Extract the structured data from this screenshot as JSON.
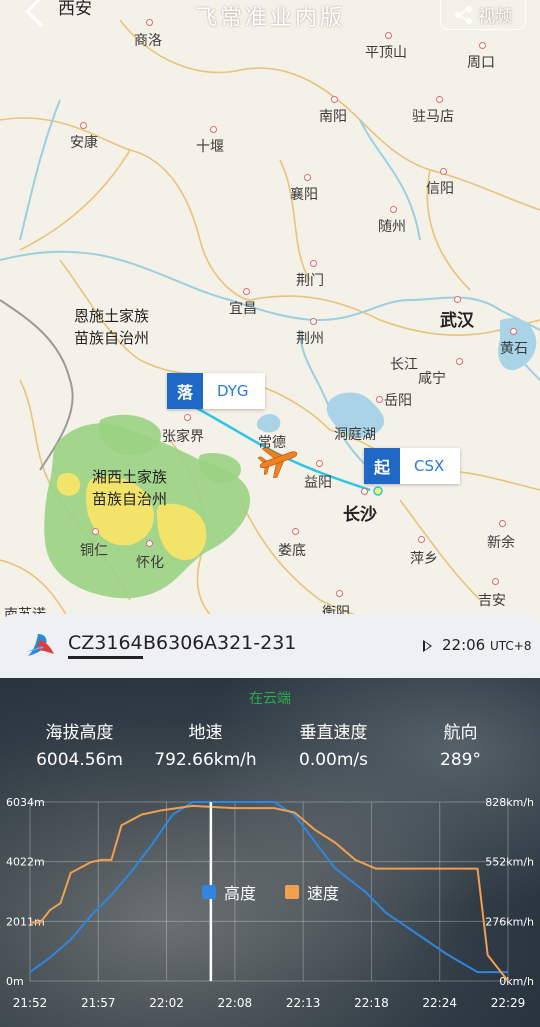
{
  "header": {
    "back_city": "西安",
    "title": "飞常准业内版",
    "video_label": "视频"
  },
  "map": {
    "cities": {
      "shangluo": "商洛",
      "pingdingshan": "平顶山",
      "zhoukou": "周口",
      "ankang": "安康",
      "nanyang": "南阳",
      "zhumadian": "驻马店",
      "shiyan": "十堰",
      "xinyang": "信阳",
      "xiangyang": "襄阳",
      "suizhou": "随州",
      "jingmen": "荆门",
      "yichang": "宜昌",
      "wuhan": "武汉",
      "huangshi": "黄石",
      "jingzhou": "荆州",
      "changjiang": "长江",
      "xianning": "咸宁",
      "yueyang": "岳阳",
      "zhangjiajie": "张家界",
      "changde": "常德",
      "dongtinghu": "洞庭湖",
      "yiyang": "益阳",
      "changsha": "长沙",
      "tongren": "铜仁",
      "huaihua": "怀化",
      "loudi": "娄底",
      "pingxiang": "萍乡",
      "xinyu": "新余",
      "hengyang": "衡阳",
      "jian": "吉安",
      "nanjiang": "南苏诺"
    },
    "regions": {
      "enshi": "恩施土家族\n苗族自治州",
      "xiangxi": "湘西土家族\n苗族自治州"
    },
    "arrival_tag": {
      "badge": "落",
      "code": "DYG"
    },
    "departure_tag": {
      "badge": "起",
      "code": "CSX"
    }
  },
  "flight": {
    "flight_no": "CZ3164",
    "registration": "B6306",
    "aircraft": "A321-231",
    "time": "22:06",
    "utc": "UTC+8"
  },
  "stats": {
    "phase": "在云端",
    "altitude_label": "海拔高度",
    "altitude_value": "6004.56m",
    "speed_label": "地速",
    "speed_value": "792.66km/h",
    "vspeed_label": "垂直速度",
    "vspeed_value": "0.00m/s",
    "heading_label": "航向",
    "heading_value": "289°"
  },
  "chart_data": {
    "type": "line",
    "x": [
      "21:52",
      "21:57",
      "22:02",
      "22:08",
      "22:13",
      "22:18",
      "22:24",
      "22:29"
    ],
    "y_left_ticks": [
      "6034m",
      "4022m",
      "2011m",
      "0m"
    ],
    "y_right_ticks": [
      "828km/h",
      "552km/h",
      "276km/h",
      "0km/h"
    ],
    "y_left_range": [
      0,
      6034
    ],
    "y_right_range": [
      0,
      828
    ],
    "x_range_minutes": [
      0,
      37
    ],
    "current_time_minutes": 14,
    "series": [
      {
        "name": "高度",
        "color": "#2f86e0",
        "axis": "left",
        "points": [
          [
            0,
            300
          ],
          [
            2,
            800
          ],
          [
            4,
            1400
          ],
          [
            6,
            2200
          ],
          [
            8,
            2900
          ],
          [
            10,
            3700
          ],
          [
            12,
            4600
          ],
          [
            14,
            5600
          ],
          [
            16,
            6034
          ],
          [
            20,
            6034
          ],
          [
            24,
            6034
          ],
          [
            26,
            5600
          ],
          [
            28,
            4700
          ],
          [
            30,
            3800
          ],
          [
            33,
            3000
          ],
          [
            35,
            2300
          ],
          [
            38,
            1600
          ],
          [
            41,
            900
          ],
          [
            44,
            300
          ],
          [
            47,
            300
          ]
        ]
      },
      {
        "name": "速度",
        "color": "#f0a050",
        "axis": "right",
        "points": [
          [
            0,
            270
          ],
          [
            1,
            270
          ],
          [
            2,
            330
          ],
          [
            3,
            360
          ],
          [
            4,
            500
          ],
          [
            6,
            550
          ],
          [
            7,
            560
          ],
          [
            8,
            560
          ],
          [
            9,
            720
          ],
          [
            11,
            770
          ],
          [
            13,
            790
          ],
          [
            16,
            810
          ],
          [
            20,
            800
          ],
          [
            24,
            800
          ],
          [
            26,
            780
          ],
          [
            28,
            700
          ],
          [
            30,
            640
          ],
          [
            32,
            560
          ],
          [
            34,
            520
          ],
          [
            40,
            520
          ],
          [
            44,
            520
          ],
          [
            45,
            120
          ],
          [
            47,
            0
          ]
        ]
      }
    ]
  }
}
